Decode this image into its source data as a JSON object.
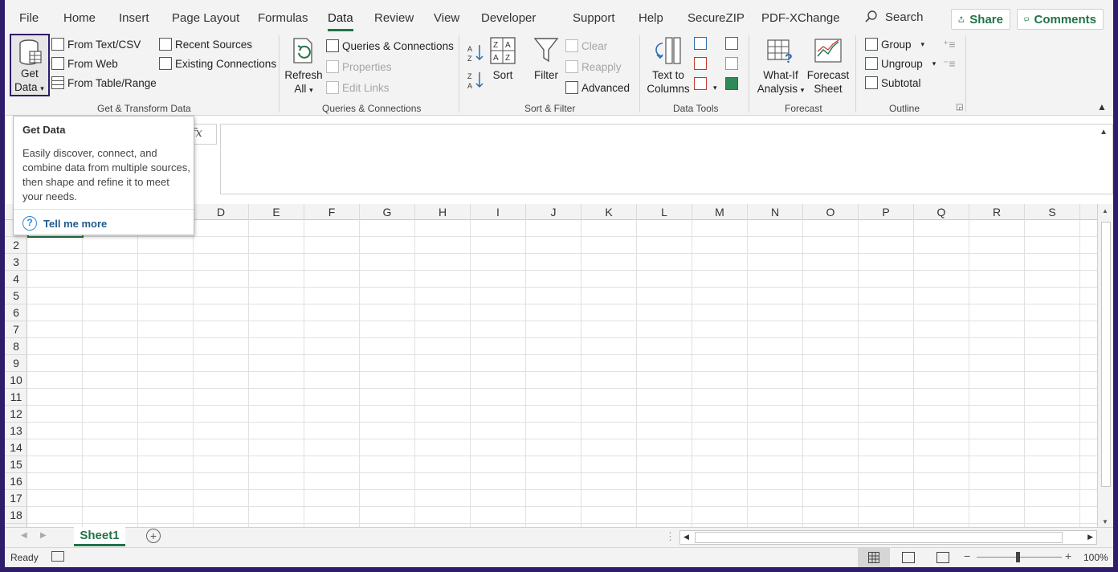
{
  "menu": {
    "tabs": [
      "File",
      "Home",
      "Insert",
      "Page Layout",
      "Formulas",
      "Data",
      "Review",
      "View",
      "Developer",
      "Support",
      "Help",
      "SecureZIP",
      "PDF-XChange"
    ],
    "search": "Search",
    "share": "Share",
    "comments": "Comments"
  },
  "ribbon": {
    "get_transform": {
      "get_data_l1": "Get",
      "get_data_l2": "Data",
      "from_text_csv": "From Text/CSV",
      "from_web": "From Web",
      "from_table_range": "From Table/Range",
      "recent_sources": "Recent Sources",
      "existing_connections": "Existing Connections",
      "label": "Get & Transform Data"
    },
    "queries": {
      "refresh_l1": "Refresh",
      "refresh_l2": "All",
      "queries_connections": "Queries & Connections",
      "properties": "Properties",
      "edit_links": "Edit Links",
      "label": "Queries & Connections"
    },
    "sort_filter": {
      "sort": "Sort",
      "filter": "Filter",
      "clear": "Clear",
      "reapply": "Reapply",
      "advanced": "Advanced",
      "label": "Sort & Filter"
    },
    "data_tools": {
      "text_to_l1": "Text to",
      "text_to_l2": "Columns",
      "label": "Data Tools"
    },
    "forecast": {
      "whatif_l1": "What-If",
      "whatif_l2": "Analysis",
      "forecast_l1": "Forecast",
      "forecast_l2": "Sheet",
      "label": "Forecast"
    },
    "outline": {
      "group": "Group",
      "ungroup": "Ungroup",
      "subtotal": "Subtotal",
      "label": "Outline"
    }
  },
  "formula": {
    "fx": "fx"
  },
  "grid": {
    "columns": [
      "D",
      "E",
      "F",
      "G",
      "H",
      "I",
      "J",
      "K",
      "L",
      "M",
      "N",
      "O",
      "P",
      "Q",
      "R",
      "S"
    ],
    "rows": [
      "2",
      "3",
      "4",
      "5",
      "6",
      "7",
      "8",
      "9",
      "10",
      "11",
      "12",
      "13",
      "14",
      "15",
      "16",
      "17",
      "18"
    ]
  },
  "tooltip": {
    "title": "Get Data",
    "body": "Easily discover, connect, and combine data from multiple sources, then shape and refine it to meet your needs.",
    "link": "Tell me more"
  },
  "sheets": {
    "active": "Sheet1"
  },
  "status": {
    "ready": "Ready",
    "zoom": "100%"
  },
  "colors": {
    "accent": "#217346",
    "frame": "#2f1c6a",
    "link": "#1e5a8e"
  }
}
